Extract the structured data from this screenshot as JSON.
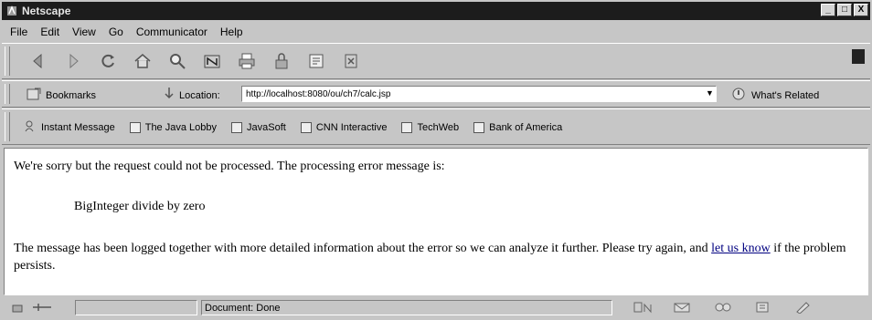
{
  "window": {
    "title": "Netscape",
    "controls": [
      "_",
      "□",
      "X"
    ]
  },
  "menu": [
    "File",
    "Edit",
    "View",
    "Go",
    "Communicator",
    "Help"
  ],
  "nav_toolbar": {
    "icons": [
      "back-icon",
      "forward-icon",
      "reload-icon",
      "home-icon",
      "search-icon",
      "netscape-icon",
      "print-icon",
      "security-icon",
      "shop-icon",
      "stop-icon"
    ]
  },
  "location_bar": {
    "bookmarks_label": "Bookmarks",
    "location_label": "Location:",
    "url": "http://localhost:8080/ou/ch7/calc.jsp",
    "whats_related_label": "What's Related"
  },
  "personal_toolbar": {
    "items": [
      "Instant Message",
      "The Java Lobby",
      "JavaSoft",
      "CNN Interactive",
      "TechWeb",
      "Bank of America"
    ]
  },
  "content": {
    "line1": "We're sorry but the request could not be processed. The processing error message is:",
    "error": "BigInteger divide by zero",
    "line3_pre": "The message has been logged together with more detailed information about the error so we can analyze it further. Please try again, and ",
    "link_text": "let us know",
    "line3_post": " if the problem persists."
  },
  "status": {
    "text": "Document: Done"
  }
}
